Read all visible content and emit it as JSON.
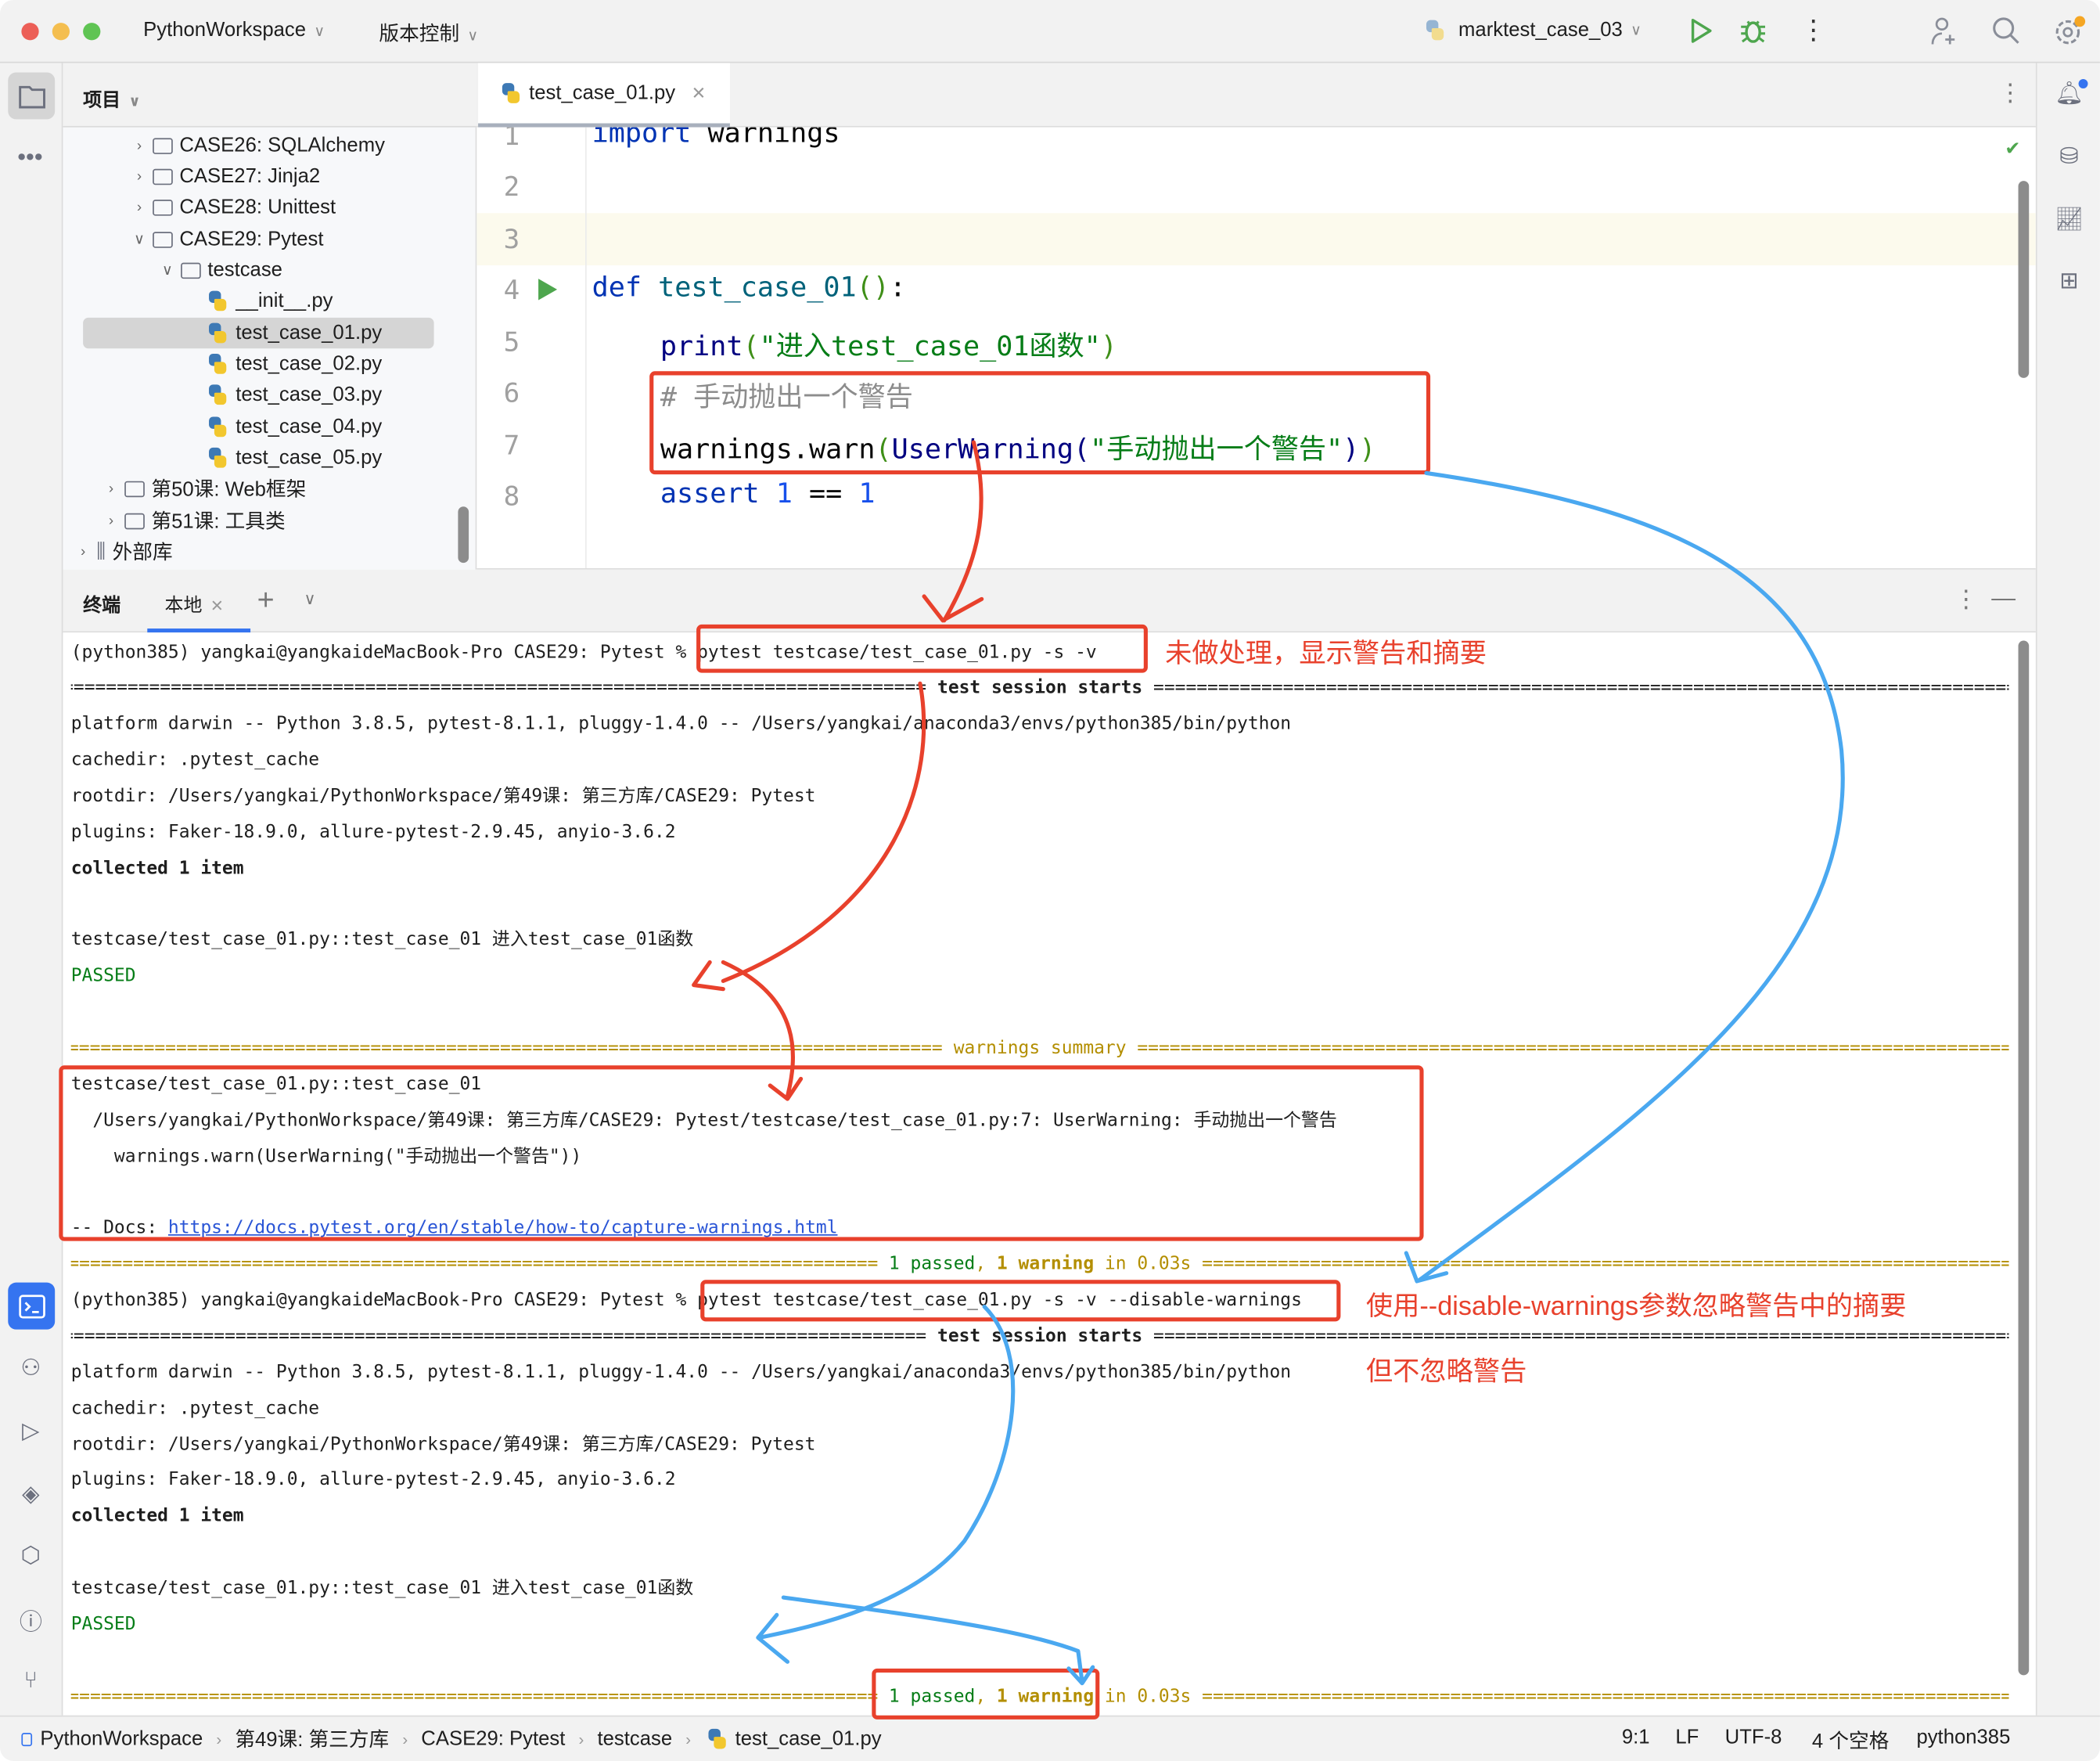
{
  "titlebar": {
    "project": "PythonWorkspace",
    "vcs": "版本控制",
    "run_config": "marktest_case_03"
  },
  "project_panel": {
    "title": "项目",
    "tree": [
      {
        "label": "CASE26: SQLAlchemy",
        "type": "module",
        "expanded": false
      },
      {
        "label": "CASE27: Jinja2",
        "type": "module",
        "expanded": false
      },
      {
        "label": "CASE28: Unittest",
        "type": "module",
        "expanded": false
      },
      {
        "label": "CASE29: Pytest",
        "type": "module",
        "expanded": true
      },
      {
        "label": "testcase",
        "type": "module",
        "expanded": true
      },
      {
        "label": "__init__.py",
        "type": "python"
      },
      {
        "label": "test_case_01.py",
        "type": "python",
        "selected": true
      },
      {
        "label": "test_case_02.py",
        "type": "python"
      },
      {
        "label": "test_case_03.py",
        "type": "python"
      },
      {
        "label": "test_case_04.py",
        "type": "python"
      },
      {
        "label": "test_case_05.py",
        "type": "python"
      },
      {
        "label": "第50课: Web框架",
        "type": "folder",
        "expanded": false
      },
      {
        "label": "第51课: 工具类",
        "type": "folder",
        "expanded": false
      },
      {
        "label": "外部库",
        "type": "library",
        "expanded": false
      }
    ]
  },
  "editor": {
    "tab": "test_case_01.py",
    "line_numbers": [
      "1",
      "2",
      "3",
      "4",
      "5",
      "6",
      "7",
      "8"
    ],
    "code": {
      "l1_kw": "import",
      "l1_rest": " warnings",
      "l4_kw": "def",
      "l4_fn": "test_case_01",
      "l4_par": "()",
      "l4_colon": ":",
      "l5_fn": "print",
      "l5_open": "(",
      "l5_str": "\"进入test_case_01函数\"",
      "l5_close": ")",
      "l6_comment": "# 手动抛出一个警告",
      "l7_a": "warnings.warn",
      "l7_open": "(",
      "l7_cls": "UserWarning",
      "l7_open2": "(",
      "l7_str": "\"手动抛出一个警告\"",
      "l7_close2": ")",
      "l7_close": ")",
      "l8_kw": "assert",
      "l8_n1": "1",
      "l8_op": " == ",
      "l8_n2": "1"
    }
  },
  "terminal": {
    "title": "终端",
    "tab": "本地",
    "run1": {
      "prompt": "(python385) yangkai@yangkaideMacBook-Pro CASE29: Pytest % ",
      "command": "pytest testcase/test_case_01.py -s -v",
      "session_starts": " test session starts ",
      "platform": "platform darwin -- Python 3.8.5, pytest-8.1.1, pluggy-1.4.0 -- /Users/yangkai/anaconda3/envs/python385/bin/python",
      "cachedir": "cachedir: .pytest_cache",
      "rootdir": "rootdir: /Users/yangkai/PythonWorkspace/第49课: 第三方库/CASE29: Pytest",
      "plugins": "plugins: Faker-18.9.0, allure-pytest-2.9.45, anyio-3.6.2",
      "collected": "collected 1 item",
      "test_line": "testcase/test_case_01.py::test_case_01 进入test_case_01函数",
      "passed": "PASSED",
      "warnings_summary": " warnings summary ",
      "warn_test": "testcase/test_case_01.py::test_case_01",
      "warn_path": "  /Users/yangkai/PythonWorkspace/第49课: 第三方库/CASE29: Pytest/testcase/test_case_01.py:7: UserWarning: 手动抛出一个警告",
      "warn_code": "    warnings.warn(UserWarning(\"手动抛出一个警告\"))",
      "docs_prefix": "-- Docs: ",
      "docs_link": "https://docs.pytest.org/en/stable/how-to/capture-warnings.html",
      "result_passed": "1 passed",
      "result_comma": ", ",
      "result_warning": "1 warning",
      "result_time": " in 0.03s "
    },
    "run2": {
      "prompt": "(python385) yangkai@yangkaideMacBook-Pro CASE29: Pytest % ",
      "command": "pytest testcase/test_case_01.py -s -v --disable-warnings",
      "session_starts": " test session starts ",
      "platform": "platform darwin -- Python 3.8.5, pytest-8.1.1, pluggy-1.4.0 -- /Users/yangkai/anaconda3/envs/python385/bin/python",
      "cachedir": "cachedir: .pytest_cache",
      "rootdir": "rootdir: /Users/yangkai/PythonWorkspace/第49课: 第三方库/CASE29: Pytest",
      "plugins": "plugins: Faker-18.9.0, allure-pytest-2.9.45, anyio-3.6.2",
      "collected": "collected 1 item",
      "test_line": "testcase/test_case_01.py::test_case_01 进入test_case_01函数",
      "passed": "PASSED",
      "result_passed": "1 passed",
      "result_comma": ", ",
      "result_warning": "1 warning",
      "result_time": " in 0.03s "
    }
  },
  "annotations": {
    "note1": "未做处理，显示警告和摘要",
    "note2": "使用--disable-warnings参数忽略警告中的摘要",
    "note3": "但不忽略警告",
    "color_red": "#e8412c",
    "color_blue": "#4aa8f0"
  },
  "statusbar": {
    "breadcrumbs": [
      "PythonWorkspace",
      "第49课: 第三方库",
      "CASE29: Pytest",
      "testcase",
      "test_case_01.py"
    ],
    "position": "9:1",
    "line_ending": "LF",
    "encoding": "UTF-8",
    "indent": "4 个空格",
    "interpreter": "python385"
  }
}
